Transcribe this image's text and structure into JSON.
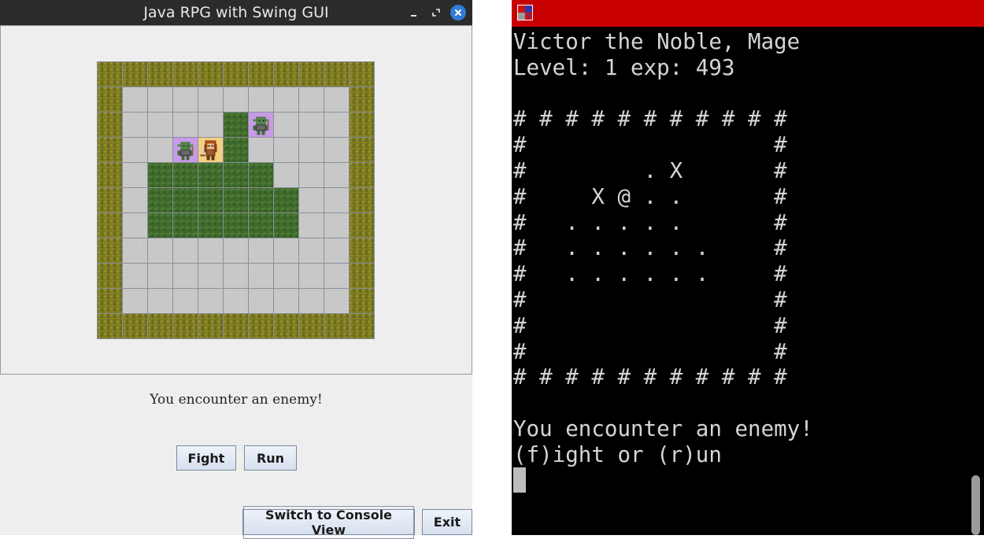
{
  "gui": {
    "title": "Java RPG with Swing GUI",
    "message": "You encounter an enemy!",
    "fight_label": "Fight",
    "run_label": "Run",
    "switch_label": "Switch to Console View",
    "exit_label": "Exit",
    "controls": {
      "minimize": "minimize-icon",
      "maximize": "maximize-icon",
      "close": "close-icon"
    },
    "map": {
      "rows": [
        "WWWWWWWWWWW",
        "W.........W",
        "W....Ge...W",
        "W..eHG....W",
        "W.GGGGG...W",
        "W.GGGGGG..W",
        "W.GGGGGG..W",
        "W.........W",
        "W.........W",
        "W.........W",
        "WWWWWWWWWWW"
      ],
      "legend": {
        "W": "wall",
        ".": "floor",
        "G": "grass",
        "e": "enemy",
        "H": "hero"
      },
      "colors": {
        "wall": "#7c7a22",
        "floor": "#c8c8c8",
        "grass": "#3f6a2c",
        "enemy_bg": "#c79be8",
        "hero_bg": "#f4cf7e",
        "grid": "#8a8f9a"
      }
    }
  },
  "terminal": {
    "app_icon": "terminal-app-icon",
    "lines": [
      "Victor the Noble, Mage",
      "Level: 1 exp: 493",
      "",
      "# # # # # # # # # # #",
      "#                   #",
      "#         . X       #",
      "#     X @ . .       #",
      "#   . . . . .       #",
      "#   . . . . . .     #",
      "#   . . . . . .     #",
      "#                   #",
      "#                   #",
      "#                   #",
      "# # # # # # # # # # #",
      "",
      "You encounter an enemy!",
      "(f)ight or (r)un"
    ],
    "colors": {
      "titlebar": "#c90000",
      "background": "#000000",
      "text": "#d4d4d4"
    }
  }
}
